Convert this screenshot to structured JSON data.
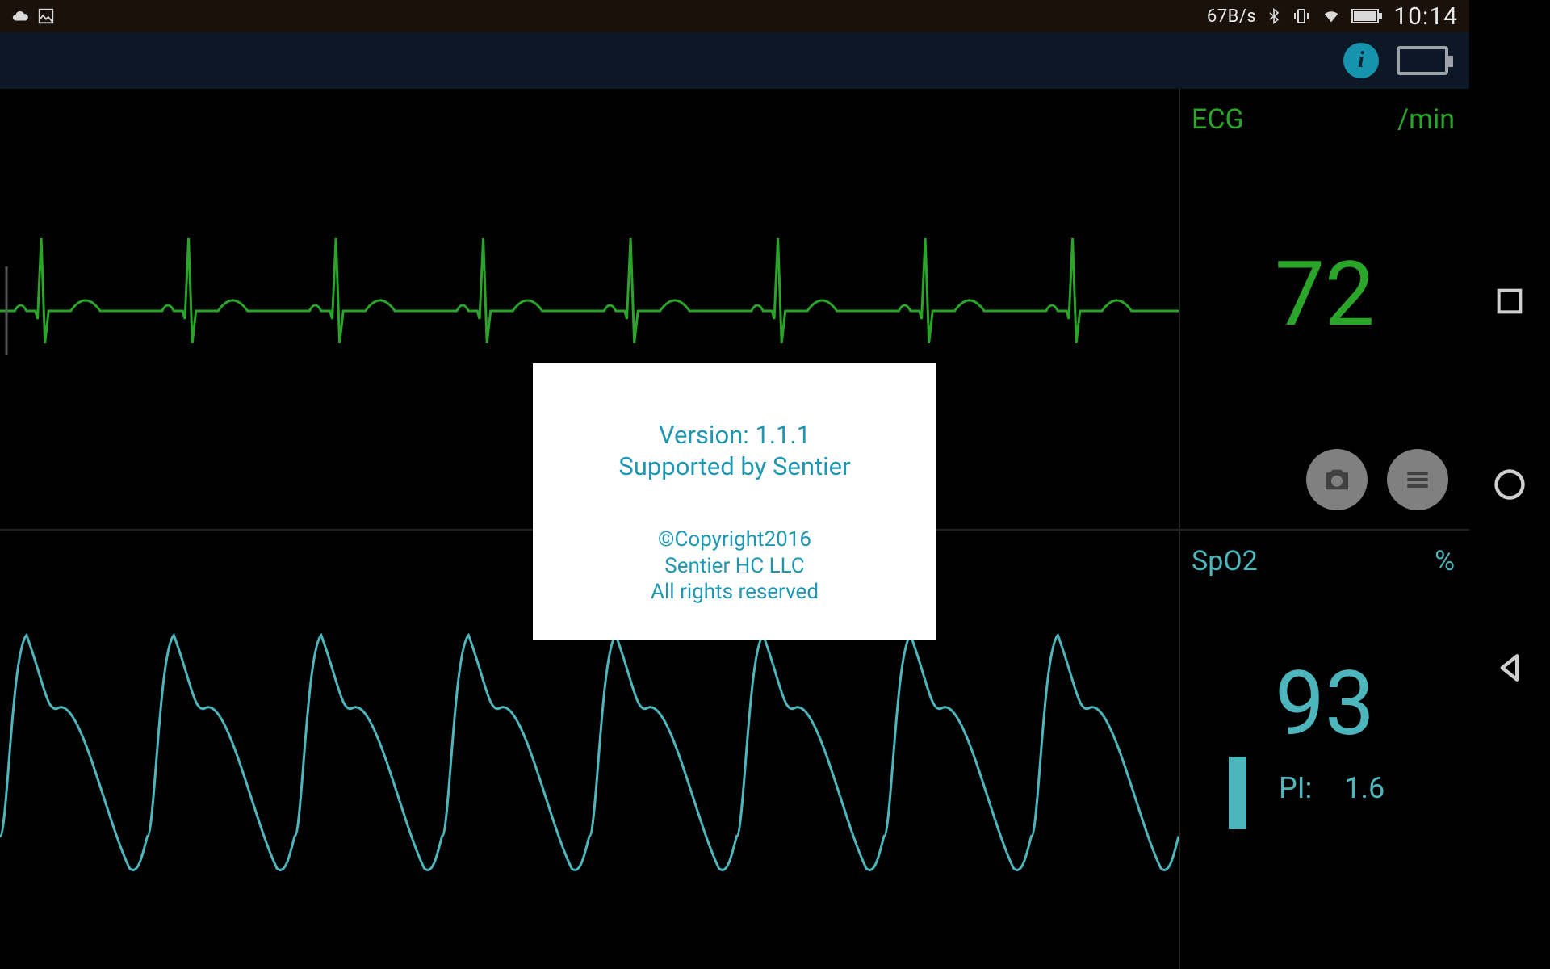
{
  "status_bar": {
    "net_speed": "67B/s",
    "clock": "10:14"
  },
  "ecg": {
    "label": "ECG",
    "unit": "/min",
    "value": "72"
  },
  "spo2": {
    "label": "SpO2",
    "unit": "%",
    "value": "93",
    "pi_label": "PI:",
    "pi_value": "1.6"
  },
  "dialog": {
    "version_line": "Version:  1.1.1",
    "support_line": "Supported by Sentier",
    "copyright": "©Copyright2016",
    "company": "Sentier HC LLC",
    "rights": "All rights reserved"
  }
}
